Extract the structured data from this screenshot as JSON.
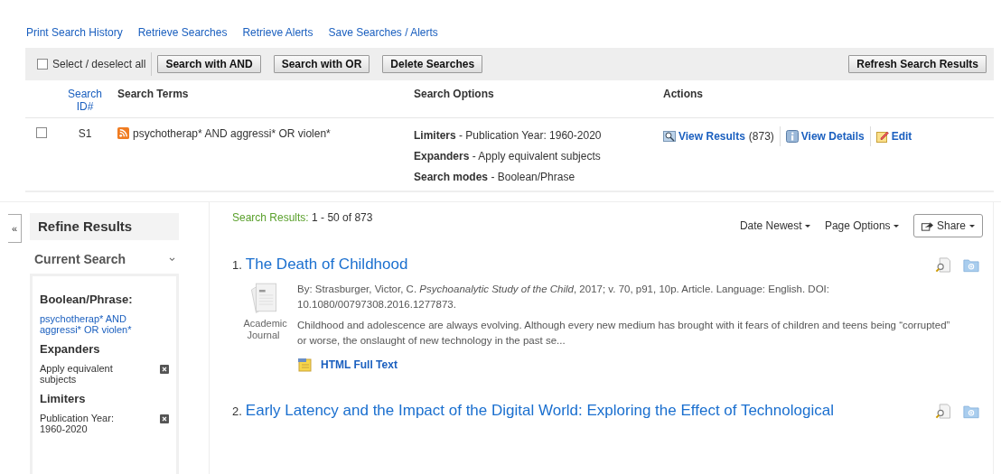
{
  "top_links": [
    "Print Search History",
    "Retrieve Searches",
    "Retrieve Alerts",
    "Save Searches / Alerts"
  ],
  "toolbar": {
    "select_all": {
      "label": "Select / deselect all",
      "checked": false
    },
    "buttons": [
      "Search with AND",
      "Search with OR",
      "Delete Searches"
    ],
    "refresh_button": "Refresh Search Results"
  },
  "history_table": {
    "columns": [
      "Search ID#",
      "Search Terms",
      "Search Options",
      "Actions"
    ],
    "rows": [
      {
        "checked": false,
        "id": "S1",
        "terms": "psychotherap* AND aggressi* OR violen*",
        "options": [
          "**Limiters** - Publication Year: 1960-2020",
          "**Expanders** - Apply equivalent subjects",
          "**Search modes** - Boolean/Phrase"
        ],
        "view_results": "View Results",
        "count": "(873)",
        "view_details": "View Details",
        "edit": "Edit"
      }
    ]
  },
  "collapse_button": "«",
  "sidebar": {
    "title": "Refine Results",
    "section": "Current Search",
    "expanded": true,
    "groups": [
      {
        "heading": "Boolean/Phrase:",
        "items": [
          {
            "kind": "link",
            "text": "psychotherap* AND aggressi* OR violen*"
          }
        ]
      },
      {
        "heading": "Expanders",
        "items": [
          {
            "kind": "removable",
            "text": "Apply equivalent subjects"
          }
        ]
      },
      {
        "heading": "Limiters",
        "items": [
          {
            "kind": "removable",
            "text": "Publication Year: 1960-2020"
          }
        ]
      }
    ]
  },
  "results": {
    "label": "Search Results:",
    "range": "1 - 50 of 873",
    "sort": "Date Newest",
    "page_options": "Page Options",
    "share": "Share",
    "items": [
      {
        "number": "1.",
        "title": "The Death of Childhood",
        "type": "Academic Journal",
        "citation": "By: Strasburger, Victor, C. *Psychoanalytic Study of the Child*, 2017; v. 70, p91, 10p. Article. Language: English. DOI: 10.1080/00797308.2016.1277873.",
        "abstract": "Childhood and adolescence are always evolving. Although every new medium has brought with it fears of children and teens being “corrupted” or worse, the onslaught of new technology in the past se...",
        "full_text": "HTML Full Text"
      },
      {
        "number": "2.",
        "title": "Early Latency and the Impact of the Digital World: Exploring the Effect of Technological"
      }
    ]
  }
}
